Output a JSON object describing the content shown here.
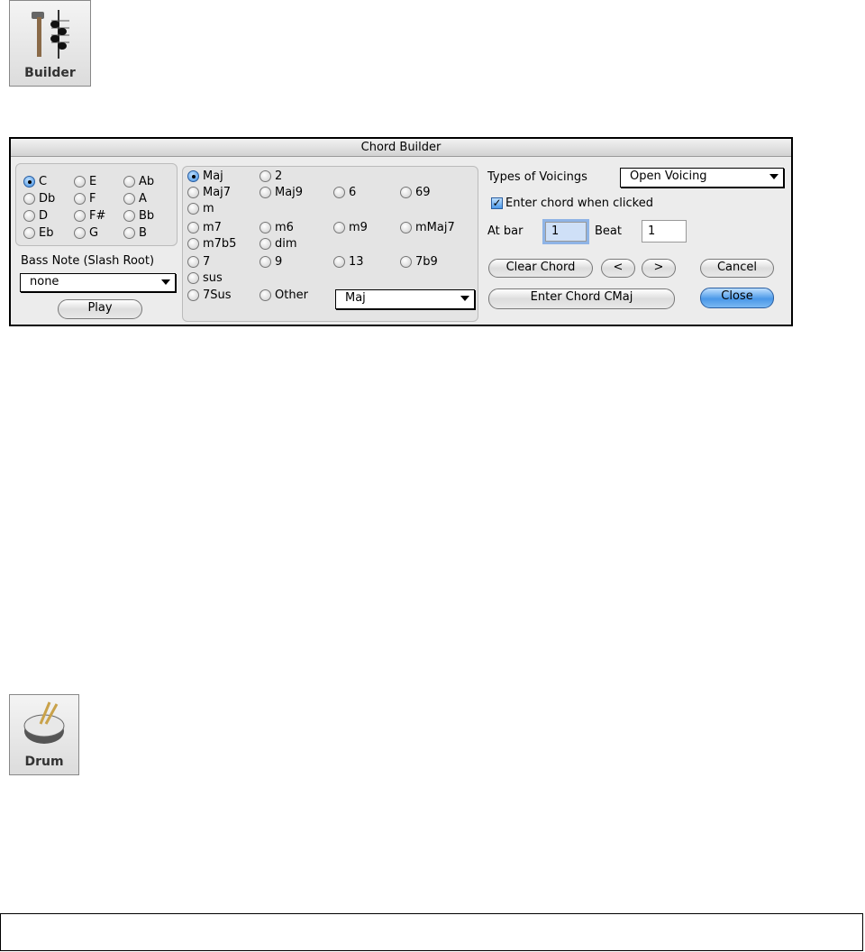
{
  "icons": {
    "builder": {
      "label": "Builder",
      "icon": "hammer-chord-icon"
    },
    "drum": {
      "label": "Drum",
      "icon": "drum-icon"
    }
  },
  "dialog": {
    "title": "Chord Builder",
    "roots": [
      {
        "label": "C",
        "checked": true
      },
      {
        "label": "Db"
      },
      {
        "label": "D"
      },
      {
        "label": "Eb"
      },
      {
        "label": "E"
      },
      {
        "label": "F"
      },
      {
        "label": "F#"
      },
      {
        "label": "G"
      },
      {
        "label": "Ab"
      },
      {
        "label": "A"
      },
      {
        "label": "Bb"
      },
      {
        "label": "B"
      }
    ],
    "bass_label": "Bass Note (Slash Root)",
    "bass_value": "none",
    "play": "Play",
    "types": [
      {
        "label": "Maj",
        "checked": true
      },
      {
        "label": "2"
      },
      {
        "label": "Maj7"
      },
      {
        "label": "Maj9"
      },
      {
        "label": "6"
      },
      {
        "label": "69"
      },
      {
        "label": "m"
      },
      {
        "label": "m7"
      },
      {
        "label": "m6"
      },
      {
        "label": "m9"
      },
      {
        "label": "mMaj7"
      },
      {
        "label": "m7b5"
      },
      {
        "label": "dim"
      },
      {
        "label": "7"
      },
      {
        "label": "9"
      },
      {
        "label": "13"
      },
      {
        "label": "7b9"
      },
      {
        "label": "sus"
      },
      {
        "label": "7Sus"
      },
      {
        "label": "Other"
      }
    ],
    "other_value": "Maj",
    "voicings_label": "Types of Voicings",
    "voicings_value": "Open Voicing",
    "enter_when_clicked": "Enter chord when clicked",
    "at_bar_label": "At bar",
    "at_bar_value": "1",
    "beat_label": "Beat",
    "beat_value": "1",
    "clear": "Clear Chord",
    "prev": "<",
    "next": ">",
    "cancel": "Cancel",
    "enter": "Enter Chord CMaj",
    "close": "Close"
  }
}
